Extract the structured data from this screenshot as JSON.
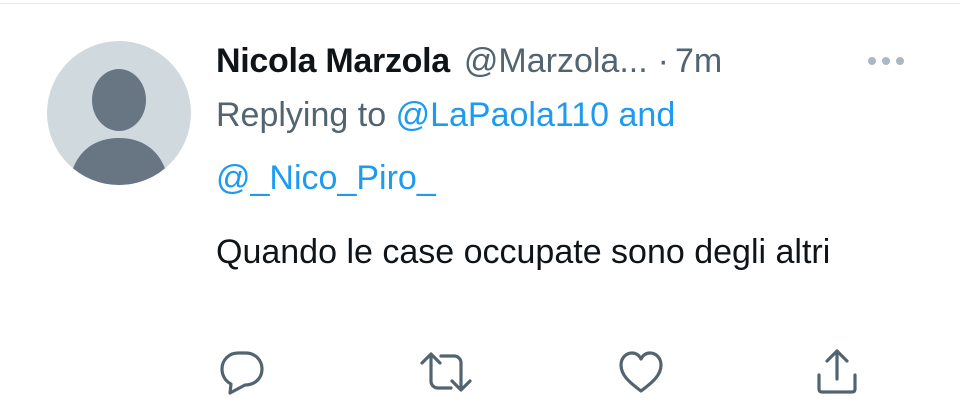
{
  "tweet": {
    "author_name": "Nicola Marzola",
    "author_handle": "@Marzola...",
    "separator": "·",
    "time": "7m",
    "replying_to_prefix": "Replying to",
    "reply_handle_1": "@LaPaola110",
    "reply_and": "and",
    "reply_handle_2": "@_Nico_Piro_",
    "text": "Quando le case occupate sono degli altri"
  },
  "icons": {
    "avatar": "default-avatar-icon",
    "more": "more-options-icon",
    "reply": "reply-icon",
    "retweet": "retweet-icon",
    "like": "heart-icon",
    "share": "share-icon"
  },
  "colors": {
    "text": "#0f1419",
    "secondary": "#536471",
    "link": "#1d9bf0",
    "avatar_bg": "#cfd9de",
    "avatar_fg": "#687684"
  }
}
